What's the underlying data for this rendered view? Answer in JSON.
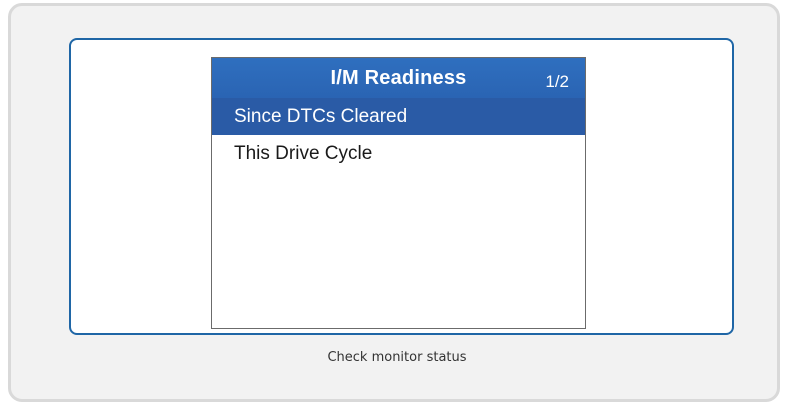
{
  "screen": {
    "title": "I/M Readiness",
    "page_indicator": "1/2",
    "menu_items": [
      {
        "label": "Since DTCs Cleared",
        "selected": true
      },
      {
        "label": "This Drive Cycle",
        "selected": false
      }
    ]
  },
  "caption": "Check monitor status",
  "colors": {
    "header_blue": "#2f6fbf",
    "selection_blue": "#2a5ba6",
    "frame_border": "#1f66a6"
  }
}
